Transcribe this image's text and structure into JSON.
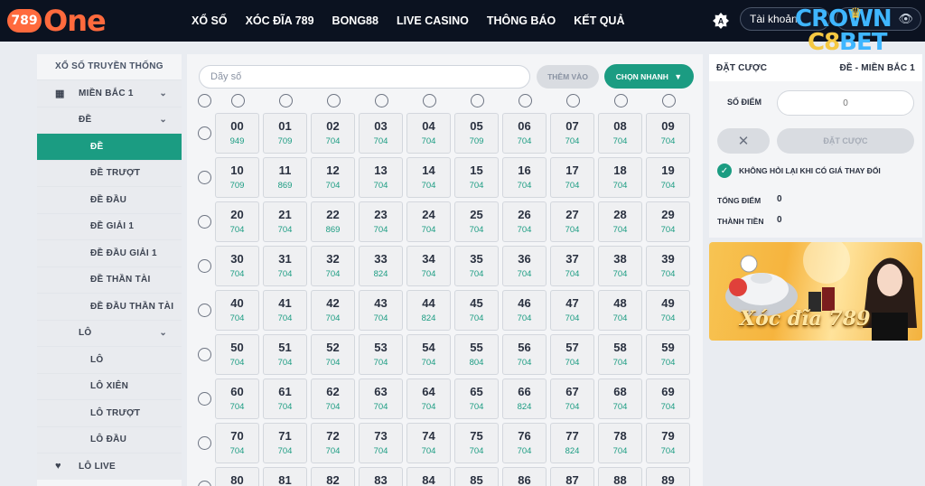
{
  "header": {
    "logo_badge": "789",
    "logo_word": "ne",
    "nav": [
      "XỔ SỐ",
      "XÓC ĐĨA 789",
      "BONG88",
      "LIVE CASINO",
      "THÔNG BÁO",
      "KẾT QUẢ"
    ],
    "account_placeholder": "Tài khoản",
    "watermark_line1": "CROWN",
    "watermark_line2": "BET"
  },
  "sidebar": {
    "title": "XỔ SỐ TRUYỀN THỐNG",
    "region": "MIỀN BẮC 1",
    "group_de": "ĐỀ",
    "items_de": [
      "ĐỀ",
      "ĐỀ TRƯỢT",
      "ĐỀ ĐẦU",
      "ĐỀ GIẢI 1",
      "ĐỀ ĐẦU GIẢI 1",
      "ĐỀ THẦN TÀI",
      "ĐỀ ĐẦU THẦN TÀI"
    ],
    "group_lo": "LÔ",
    "items_lo": [
      "LÔ",
      "LÔ XIÊN",
      "LÔ TRƯỢT",
      "LÔ ĐẦU"
    ],
    "live": "LÔ LIVE"
  },
  "main": {
    "input_placeholder": "Dãy số",
    "add_label": "THÊM VÀO",
    "quick_label": "CHỌN NHANH",
    "rows": [
      {
        "nums": [
          "00",
          "01",
          "02",
          "03",
          "04",
          "05",
          "06",
          "07",
          "08",
          "09"
        ],
        "odds": [
          "949",
          "709",
          "704",
          "704",
          "704",
          "709",
          "704",
          "704",
          "704",
          "704"
        ]
      },
      {
        "nums": [
          "10",
          "11",
          "12",
          "13",
          "14",
          "15",
          "16",
          "17",
          "18",
          "19"
        ],
        "odds": [
          "709",
          "869",
          "704",
          "704",
          "704",
          "704",
          "704",
          "704",
          "704",
          "704"
        ]
      },
      {
        "nums": [
          "20",
          "21",
          "22",
          "23",
          "24",
          "25",
          "26",
          "27",
          "28",
          "29"
        ],
        "odds": [
          "704",
          "704",
          "869",
          "704",
          "704",
          "704",
          "704",
          "704",
          "704",
          "704"
        ]
      },
      {
        "nums": [
          "30",
          "31",
          "32",
          "33",
          "34",
          "35",
          "36",
          "37",
          "38",
          "39"
        ],
        "odds": [
          "704",
          "704",
          "704",
          "824",
          "704",
          "704",
          "704",
          "704",
          "704",
          "704"
        ]
      },
      {
        "nums": [
          "40",
          "41",
          "42",
          "43",
          "44",
          "45",
          "46",
          "47",
          "48",
          "49"
        ],
        "odds": [
          "704",
          "704",
          "704",
          "704",
          "824",
          "704",
          "704",
          "704",
          "704",
          "704"
        ]
      },
      {
        "nums": [
          "50",
          "51",
          "52",
          "53",
          "54",
          "55",
          "56",
          "57",
          "58",
          "59"
        ],
        "odds": [
          "704",
          "704",
          "704",
          "704",
          "704",
          "804",
          "704",
          "704",
          "704",
          "704"
        ]
      },
      {
        "nums": [
          "60",
          "61",
          "62",
          "63",
          "64",
          "65",
          "66",
          "67",
          "68",
          "69"
        ],
        "odds": [
          "704",
          "704",
          "704",
          "704",
          "704",
          "704",
          "824",
          "704",
          "704",
          "704"
        ]
      },
      {
        "nums": [
          "70",
          "71",
          "72",
          "73",
          "74",
          "75",
          "76",
          "77",
          "78",
          "79"
        ],
        "odds": [
          "704",
          "704",
          "704",
          "704",
          "704",
          "704",
          "704",
          "824",
          "704",
          "704"
        ]
      },
      {
        "nums": [
          "80",
          "81",
          "82",
          "83",
          "84",
          "85",
          "86",
          "87",
          "88",
          "89"
        ],
        "odds": [
          "",
          "",
          "",
          "",
          "",
          "",
          "",
          "",
          "",
          ""
        ]
      }
    ]
  },
  "bet": {
    "title": "ĐẶT CƯỢC",
    "mode": "ĐỀ - MIỀN BẮC 1",
    "points_label": "SỐ ĐIỂM",
    "points_placeholder": "0",
    "place_label": "ĐẶT CƯỢC",
    "no_ask_label": "KHÔNG HỎI LẠI KHI CÓ GIÁ THAY ĐỔI",
    "total_points_label": "TỔNG ĐIỂM",
    "total_points": "0",
    "amount_label": "THÀNH TIỀN",
    "amount": "0"
  },
  "banner": {
    "text": "Xóc đĩa 789"
  },
  "colors": {
    "accent": "#1b9c82",
    "brand": "#ff6a3d",
    "header_bg": "#0b1220"
  }
}
